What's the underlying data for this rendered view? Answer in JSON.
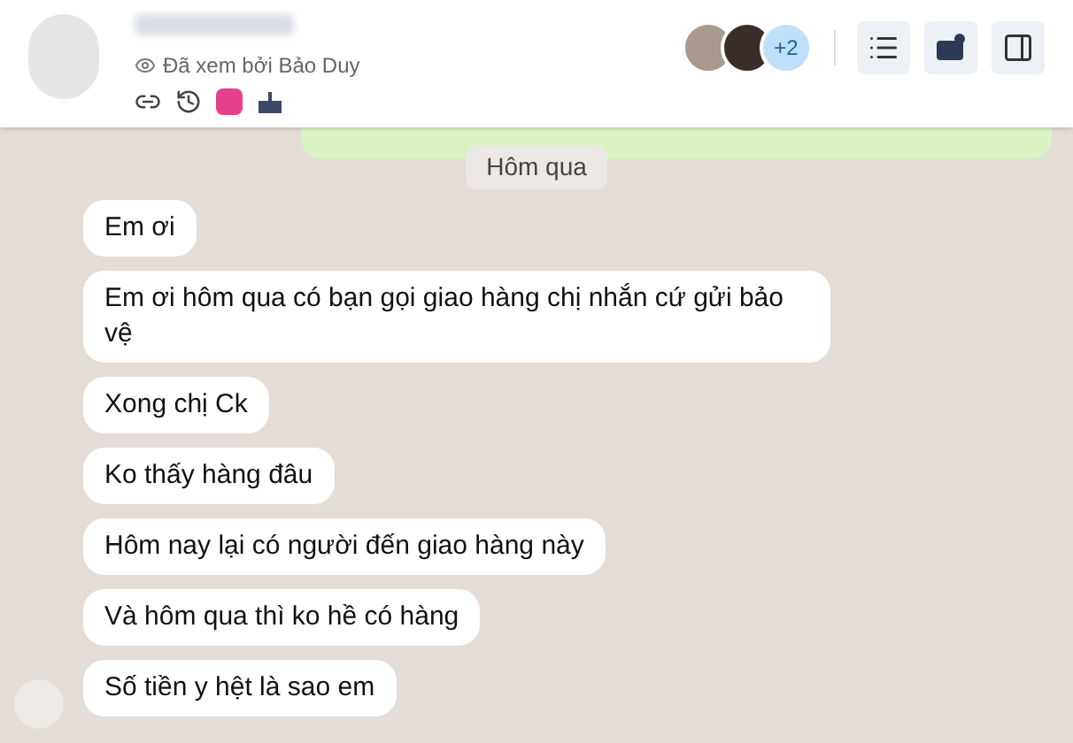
{
  "header": {
    "seen_by": "Đã xem bởi Bảo Duy",
    "more_members": "+2"
  },
  "date_divider": "Hôm qua",
  "messages": [
    {
      "text": "Em ơi"
    },
    {
      "text": "Em ơi hôm qua có bạn gọi giao hàng chị nhắn cứ gửi bảo vệ"
    },
    {
      "text": "Xong chị Ck"
    },
    {
      "text": "Ko thấy hàng đâu"
    },
    {
      "text": "Hôm nay lại có người đến giao hàng này"
    },
    {
      "text": "Và hôm qua thì ko hề có hàng"
    },
    {
      "text": "Số tiền y hệt là sao em"
    }
  ]
}
